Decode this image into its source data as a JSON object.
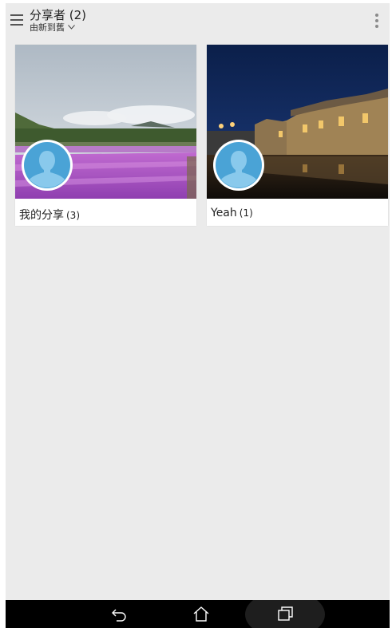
{
  "appbar": {
    "title": "分享者 (2)",
    "sort_label": "由新到舊",
    "menu_icon": "hamburger-menu-icon",
    "overflow_icon": "more-vert-icon"
  },
  "cards": [
    {
      "name": "我的分享",
      "count": "(3)"
    },
    {
      "name": "Yeah",
      "count": "(1)"
    }
  ],
  "navbar": {
    "buttons": [
      "back-icon",
      "home-icon",
      "recent-apps-icon"
    ]
  },
  "colors": {
    "background": "#ebebeb",
    "avatar": "#4aa3d6",
    "navbar": "#000000"
  }
}
